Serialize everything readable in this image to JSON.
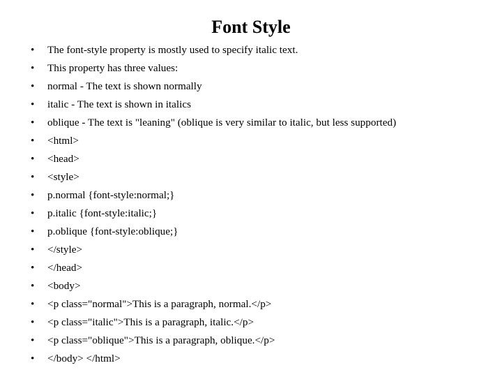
{
  "slide": {
    "title": "Font Style",
    "bullet_marker": "•",
    "text_color": "#000000",
    "background_color": "#ffffff",
    "bullets": [
      {
        "text": "The font-style property is mostly used to specify italic text."
      },
      {
        "text": "This property has three values:"
      },
      {
        "text": "normal - The text is shown normally"
      },
      {
        "text": "italic - The text is shown in italics"
      },
      {
        "text": "oblique - The text is \"leaning\" (oblique is very similar to italic, but less supported)"
      },
      {
        "text": "<html>"
      },
      {
        "text": "<head>"
      },
      {
        "text": "<style>"
      },
      {
        "text": "p.normal {font-style:normal;}"
      },
      {
        "text": "p.italic {font-style:italic;}"
      },
      {
        "text": "p.oblique {font-style:oblique;}"
      },
      {
        "text": "</style>"
      },
      {
        "text": "</head>"
      },
      {
        "text": "<body>"
      },
      {
        "text": "<p class=\"normal\">This is a paragraph, normal.</p>"
      },
      {
        "text": "<p class=\"italic\">This is a paragraph, italic.</p>"
      },
      {
        "text": "<p class=\"oblique\">This is a paragraph, oblique.</p>"
      },
      {
        "text": "</body> </html>"
      }
    ]
  }
}
